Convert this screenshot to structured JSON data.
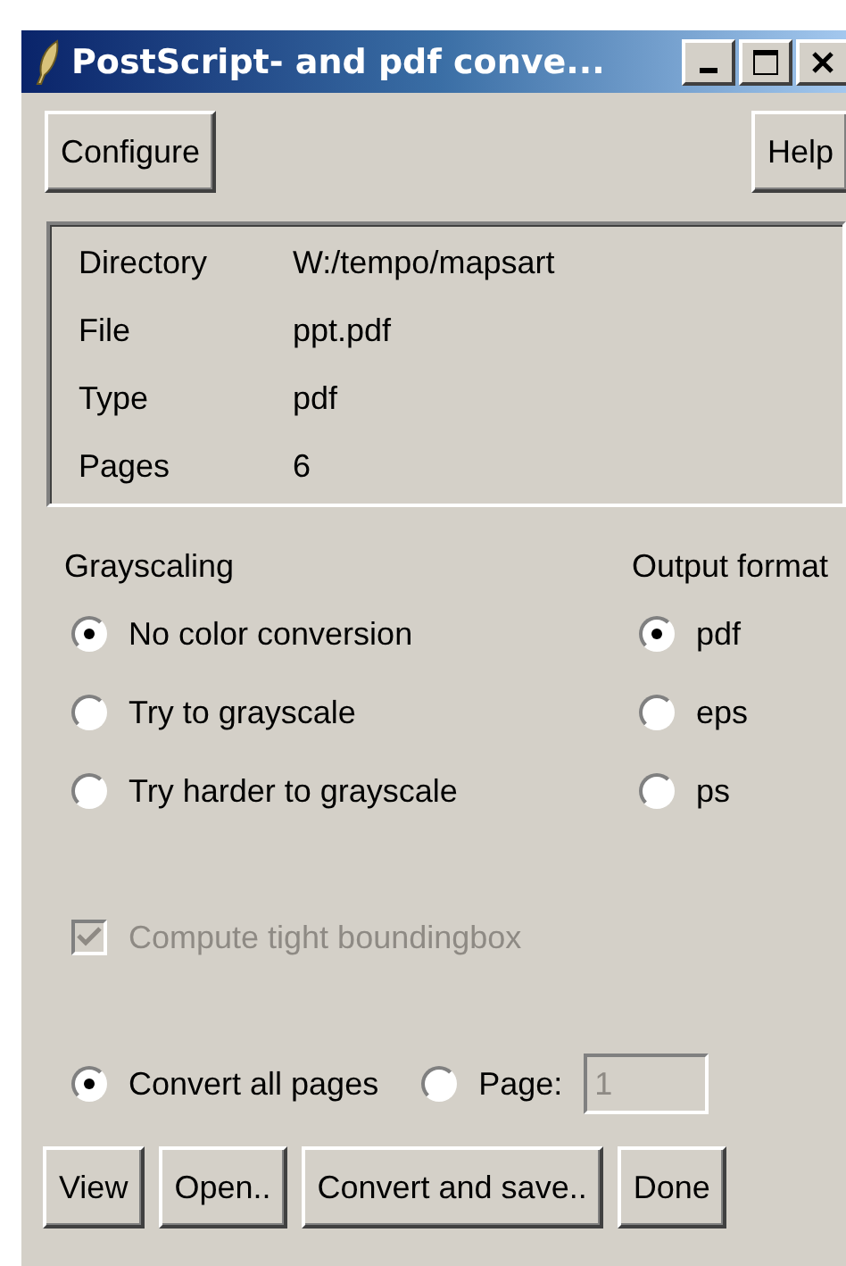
{
  "window": {
    "title": "PostScript- and pdf conve..."
  },
  "top_buttons": [
    {
      "label": "Configure"
    },
    {
      "label": "Help"
    }
  ],
  "info": [
    {
      "label": "Directory",
      "value": "W:/tempo/mapsart"
    },
    {
      "label": "File",
      "value": "ppt.pdf"
    },
    {
      "label": "Type",
      "value": "pdf"
    },
    {
      "label": "Pages",
      "value": "6"
    }
  ],
  "grayscaling": {
    "heading": "Grayscaling",
    "options": [
      {
        "label": "No color conversion",
        "selected": true
      },
      {
        "label": "Try to grayscale",
        "selected": false
      },
      {
        "label": "Try harder to grayscale",
        "selected": false
      }
    ]
  },
  "output_format": {
    "heading": "Output format",
    "options": [
      {
        "label": "pdf",
        "selected": true
      },
      {
        "label": "eps",
        "selected": false
      },
      {
        "label": "ps",
        "selected": false
      }
    ]
  },
  "tight_boundingbox": {
    "label": "Compute tight boundingbox",
    "checked": true,
    "disabled": true
  },
  "page_range": {
    "options": [
      {
        "label": "Convert all pages",
        "selected": true
      },
      {
        "label": "Page:",
        "selected": false
      }
    ],
    "page_field": {
      "value": "1",
      "disabled": true
    }
  },
  "bottom_buttons": [
    {
      "label": "View"
    },
    {
      "label": "Open.."
    },
    {
      "label": "Convert and save.."
    },
    {
      "label": "Done"
    }
  ]
}
